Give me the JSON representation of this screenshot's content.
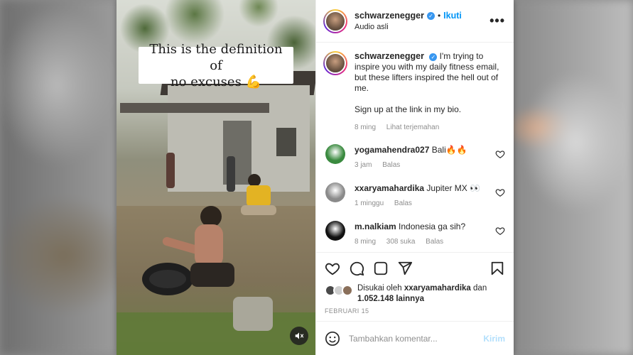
{
  "caption_overlay": {
    "line1": "This is the definition of",
    "line2": "no excuses 💪"
  },
  "header": {
    "username": "schwarzenegger",
    "dot": "•",
    "follow_label": "Ikuti",
    "audio_label": "Audio asli",
    "more_label": "•••"
  },
  "post": {
    "username": "schwarzenegger",
    "text1": "I'm trying to inspire you with my daily fitness email, but these lifters inspired the hell out of me.",
    "text2": "Sign up at the link in my bio.",
    "time": "8 ming",
    "translate_label": "Lihat terjemahan"
  },
  "comments": [
    {
      "username": "yogamahendra027",
      "text": "Bali🔥🔥",
      "time": "3 jam",
      "likes": "",
      "reply": "Balas",
      "avatar_color": "#3a8a3f"
    },
    {
      "username": "xxaryamahardika",
      "text": "Jupiter MX 👀",
      "time": "1 minggu",
      "likes": "",
      "reply": "Balas",
      "avatar_color": "#8a8a8a"
    },
    {
      "username": "m.nalkiam",
      "text": "Indonesia ga sih?",
      "time": "8 ming",
      "likes": "308 suka",
      "reply": "Balas",
      "avatar_color": "#111111"
    }
  ],
  "likes": {
    "prefix": "Disukai oleh ",
    "user": "xxaryamahardika",
    "middle": " dan",
    "count": "1.052.148 lainnya"
  },
  "date": "FEBRUARI 15",
  "add_comment": {
    "placeholder": "Tambahkan komentar...",
    "post_label": "Kirim"
  },
  "icons": {
    "heart": "heart-icon",
    "comment": "comment-icon",
    "repost": "repost-icon",
    "share": "share-icon",
    "save": "bookmark-icon",
    "emoji": "emoji-icon",
    "mute": "mute-icon"
  },
  "colors": {
    "accent": "#0095f6",
    "verified": "#3897f0",
    "muted": "#8e8e8e"
  }
}
